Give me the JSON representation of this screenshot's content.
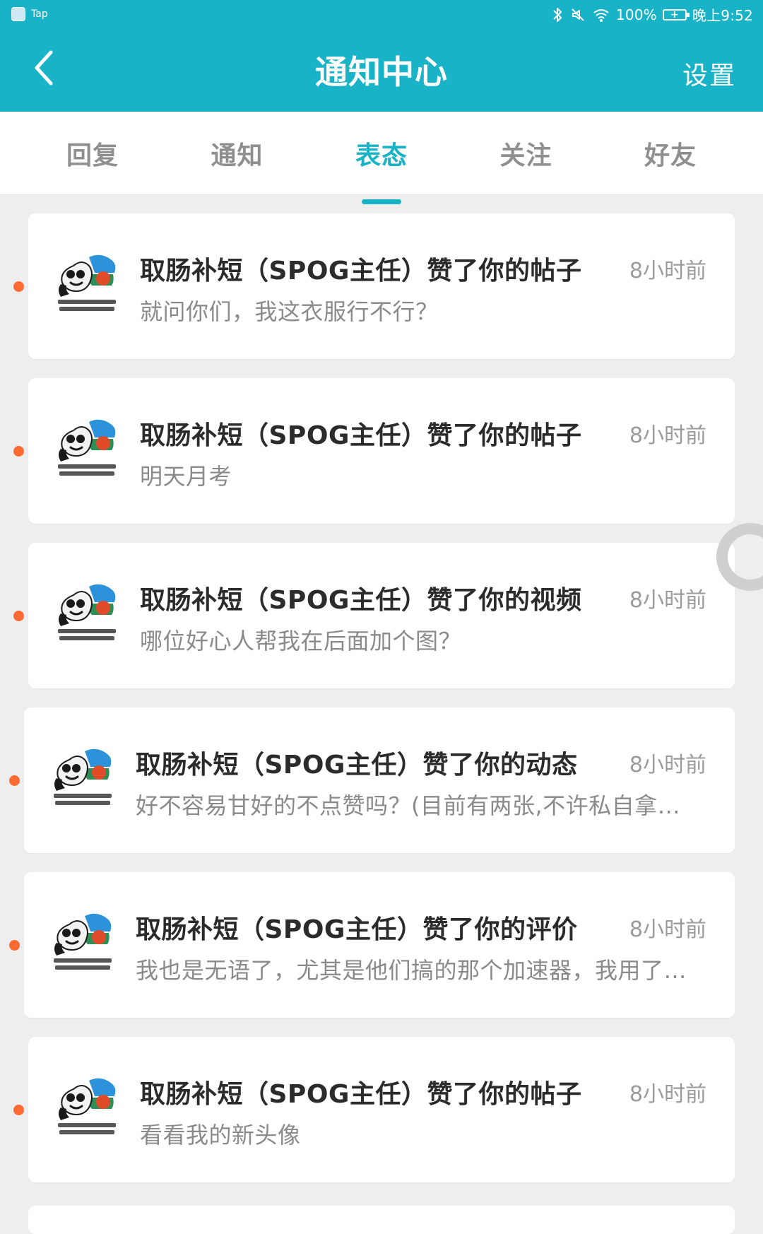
{
  "status_bar": {
    "app_label": "Tap",
    "battery_percent": "100%",
    "time": "晚上9:52",
    "icons": [
      "bluetooth-icon",
      "mute-icon",
      "wifi-icon",
      "battery-charging-icon"
    ]
  },
  "header": {
    "title": "通知中心",
    "settings_label": "设置",
    "back_icon": "chevron-left-icon"
  },
  "tabs": {
    "items": [
      {
        "label": "回复",
        "active": false
      },
      {
        "label": "通知",
        "active": false
      },
      {
        "label": "表态",
        "active": true
      },
      {
        "label": "关注",
        "active": false
      },
      {
        "label": "好友",
        "active": false
      }
    ]
  },
  "notifications": [
    {
      "title": "取肠补短（SPOG主任）赞了你的帖子",
      "time": "8小时前",
      "snippet": "就问你们，我这衣服行不行？",
      "unread": true
    },
    {
      "title": "取肠补短（SPOG主任）赞了你的帖子",
      "time": "8小时前",
      "snippet": "明天月考",
      "unread": true
    },
    {
      "title": "取肠补短（SPOG主任）赞了你的视频",
      "time": "8小时前",
      "snippet": "哪位好心人帮我在后面加个图？",
      "unread": true
    },
    {
      "title": "取肠补短（SPOG主任）赞了你的动态",
      "time": "8小时前",
      "snippet": "好不容易甘好的不点赞吗？(目前有两张,不许私自拿…",
      "unread": true
    },
    {
      "title": "取肠补短（SPOG主任）赞了你的评价",
      "time": "8小时前",
      "snippet": "我也是无语了，尤其是他们搞的那个加速器，我用了…",
      "unread": true
    },
    {
      "title": "取肠补短（SPOG主任）赞了你的帖子",
      "time": "8小时前",
      "snippet": "看看我的新头像",
      "unread": true
    }
  ],
  "colors": {
    "accent": "#18b3c6",
    "unread_dot": "#ff6a33",
    "background": "#eeeeee",
    "text_primary": "#2b2b2b",
    "text_secondary": "#8a8a8a"
  }
}
